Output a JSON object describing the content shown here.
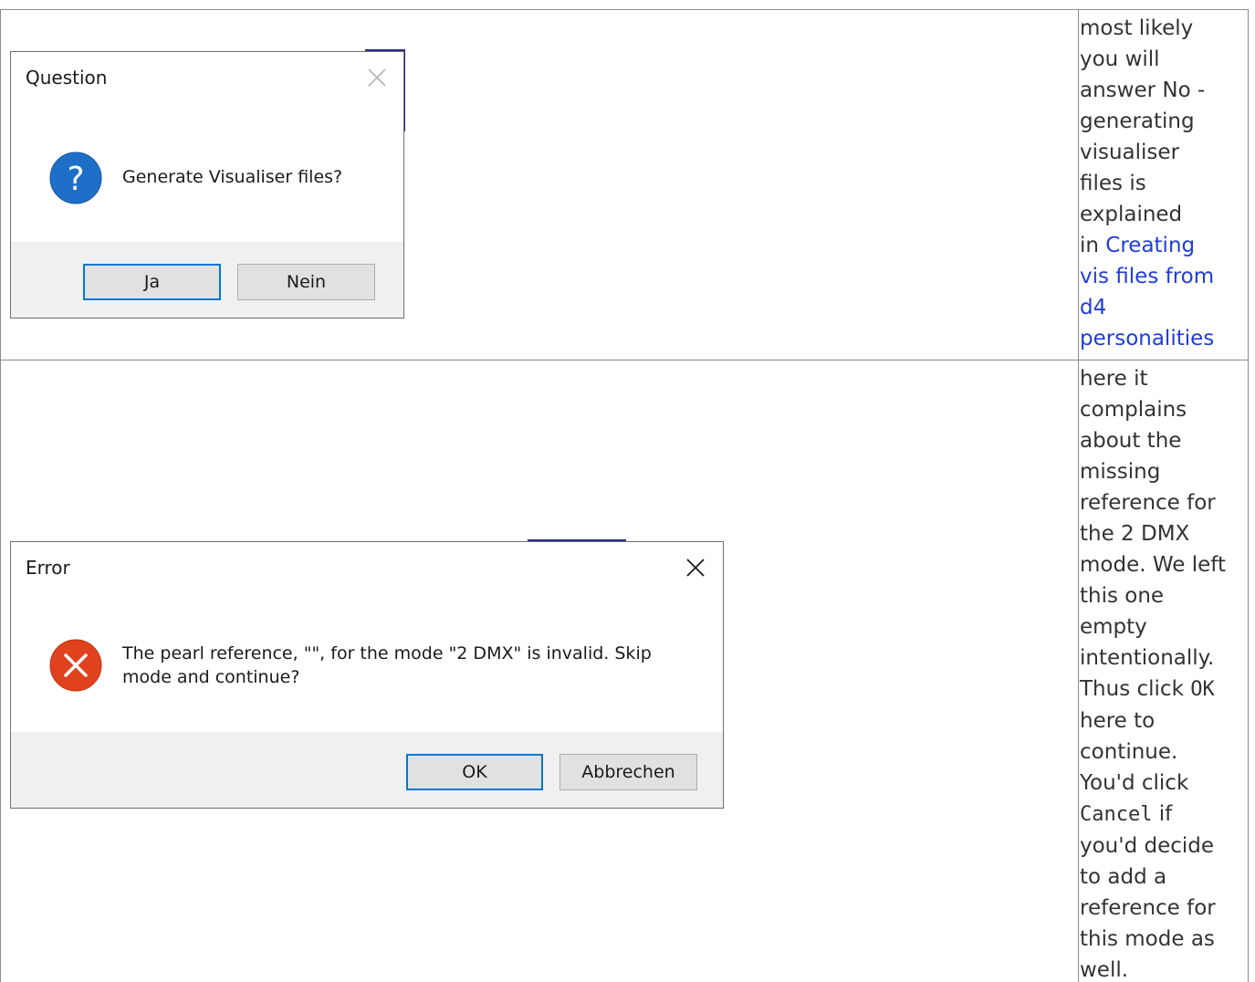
{
  "colors": {
    "link": "#1f3ce0",
    "question_icon": "#1e6fc8",
    "error_icon": "#e0411f",
    "default_button_border": "#0078d7"
  },
  "row1": {
    "dialog": {
      "title": "Question",
      "icon": "question-icon",
      "message": "Generate Visualiser files?",
      "buttons": {
        "yes": "Ja",
        "no": "Nein"
      }
    },
    "note_text": "most likely\nyou will\nanswer No -\ngenerating\nvisualiser\nfiles is\nexplained\nin ",
    "note_link": "Creating\nvis files from\nd4\npersonalities"
  },
  "row2": {
    "dialog": {
      "title": "Error",
      "icon": "error-icon",
      "message": "The pearl reference, \"\", for the mode \"2 DMX\" is invalid. Skip\nmode and continue?",
      "buttons": {
        "ok": "OK",
        "cancel": "Abbrechen"
      }
    },
    "note_part1": "here it\ncomplains\nabout the\nmissing\nreference for\nthe 2 DMX\nmode. We left\nthis one\nempty\nintentionally.\nThus click ",
    "note_code_ok": "OK",
    "note_part2": "\nhere to\ncontinue.\nYou'd click\n",
    "note_code_cancel": "Cancel",
    "note_part3": " if\nyou'd decide\nto add a\nreference for\nthis mode as\nwell."
  }
}
